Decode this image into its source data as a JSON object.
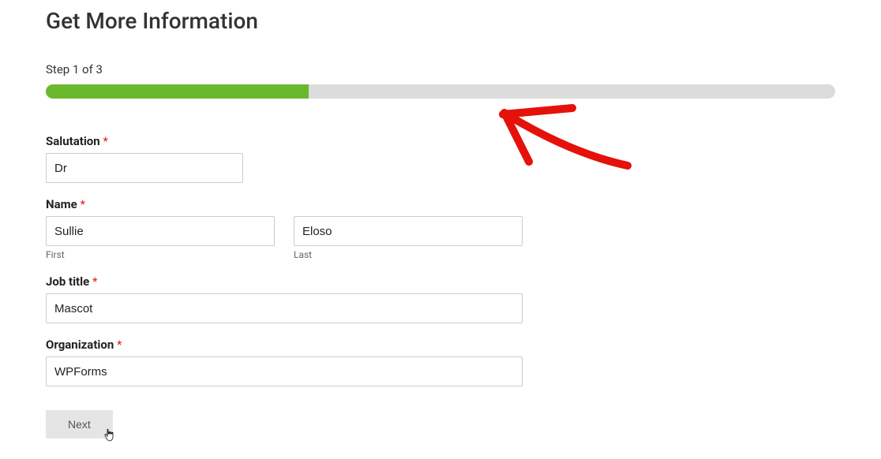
{
  "form": {
    "title": "Get More Information",
    "step_indicator": "Step 1 of 3",
    "progress_percent": 33.3
  },
  "fields": {
    "salutation": {
      "label": "Salutation",
      "required": "*",
      "value": "Dr"
    },
    "name": {
      "label": "Name",
      "required": "*",
      "first": {
        "value": "Sullie",
        "sublabel": "First"
      },
      "last": {
        "value": "Eloso",
        "sublabel": "Last"
      }
    },
    "job_title": {
      "label": "Job title",
      "required": "*",
      "value": "Mascot"
    },
    "organization": {
      "label": "Organization",
      "required": "*",
      "value": "WPForms"
    }
  },
  "buttons": {
    "next": "Next"
  },
  "colors": {
    "progress_fill": "#6ab82d",
    "required": "#e31b1b",
    "annotation": "#e5110b"
  }
}
